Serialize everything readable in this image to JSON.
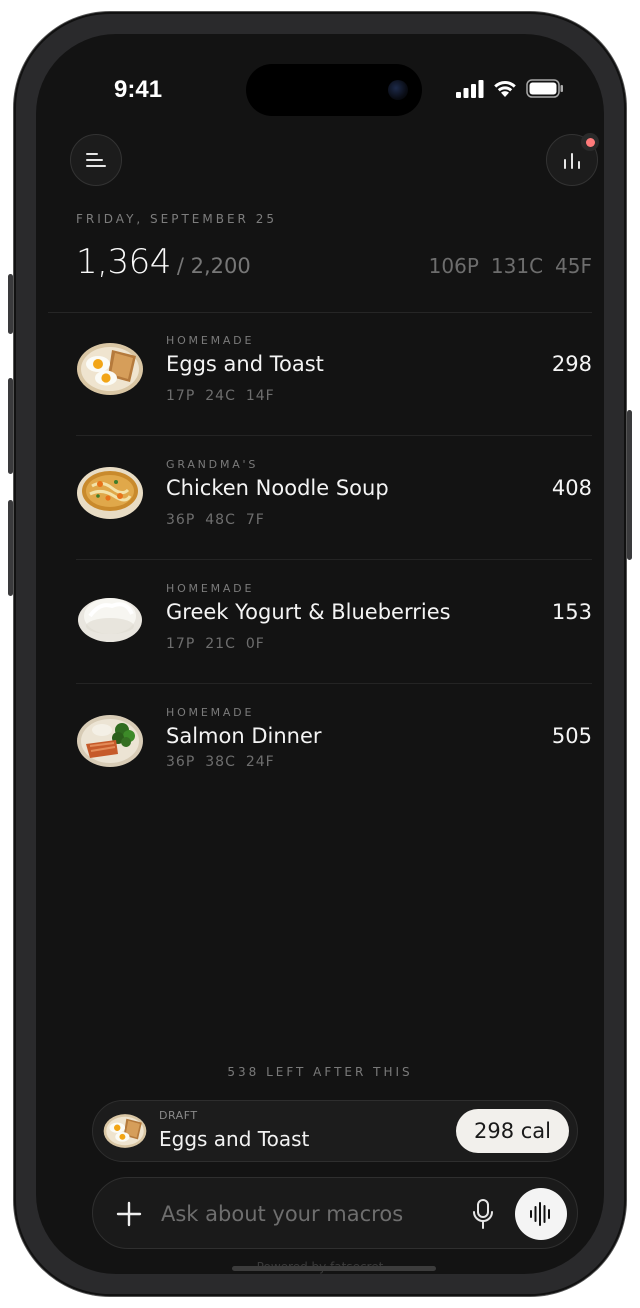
{
  "status_bar": {
    "time": "9:41"
  },
  "header": {
    "menu_icon": "menu-lines-icon",
    "stats_icon": "bar-chart-icon",
    "has_notification": true
  },
  "summary": {
    "date": "FRIDAY, SEPTEMBER 25",
    "consumed": "1,364",
    "goal": "/ 2,200",
    "protein": "106P",
    "carbs": "131C",
    "fat": "45F"
  },
  "meals": [
    {
      "source": "HOMEMADE",
      "name": "Eggs and Toast",
      "calories": "298",
      "protein": "17P",
      "carbs": "24C",
      "fat": "14F",
      "thumb": "eggs-toast"
    },
    {
      "source": "GRANDMA'S",
      "name": "Chicken Noodle Soup",
      "calories": "408",
      "protein": "36P",
      "carbs": "48C",
      "fat": "7F",
      "thumb": "soup"
    },
    {
      "source": "HOMEMADE",
      "name": "Greek Yogurt & Blueberries",
      "calories": "153",
      "protein": "17P",
      "carbs": "21C",
      "fat": "0F",
      "thumb": "yogurt"
    },
    {
      "source": "HOMEMADE",
      "name": "Salmon Dinner",
      "calories": "505",
      "protein": "36P",
      "carbs": "38C",
      "fat": "24F",
      "thumb": "salmon"
    }
  ],
  "remaining_note": "538 LEFT AFTER THIS",
  "draft": {
    "label": "DRAFT",
    "name": "Eggs and Toast",
    "calories": "298 cal"
  },
  "composer": {
    "placeholder": "Ask about your macros",
    "plus_icon": "plus-icon",
    "mic_icon": "microphone-icon",
    "voice_icon": "voice-wave-icon"
  },
  "footer": {
    "powered_by": "Powered by fatsecret"
  },
  "colors": {
    "background": "#131313",
    "text_primary": "#f4f4f4",
    "text_muted": "#6e6e6e",
    "notification": "#ff7b7b",
    "pill": "#f2f0ec"
  }
}
